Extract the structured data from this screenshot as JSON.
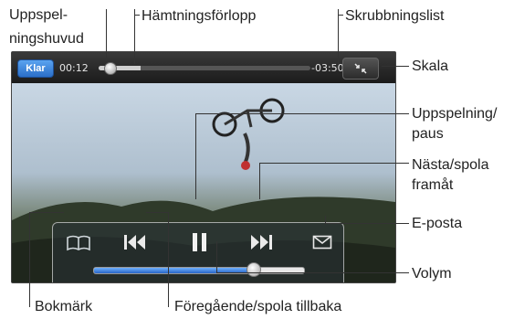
{
  "callouts": {
    "playhead": "Uppspel-\nningshuvud",
    "download_progress": "Hämtningsförlopp",
    "scrubber_bar": "Skrubbningslist",
    "scale": "Skala",
    "play_pause": "Uppspelning/\npaus",
    "next_forward": "Nästa/spola\nframåt",
    "email": "E-posta",
    "volume": "Volym",
    "bookmark": "Bokmärk",
    "previous_rewind": "Föregående/spola tillbaka"
  },
  "player": {
    "done_label": "Klar",
    "elapsed": "00:12",
    "remaining": "-03:50",
    "playhead_fraction": 0.05,
    "download_fraction": 0.2,
    "volume_fraction": 0.76
  },
  "colors": {
    "done_button": "#2b6fc8",
    "volume_fill": "#2764c5"
  },
  "icons": {
    "bookmark": "bookmark-icon",
    "previous": "previous-rewind-icon",
    "pause": "pause-icon",
    "next": "next-forward-icon",
    "email": "email-icon",
    "scale": "scale-icon"
  }
}
